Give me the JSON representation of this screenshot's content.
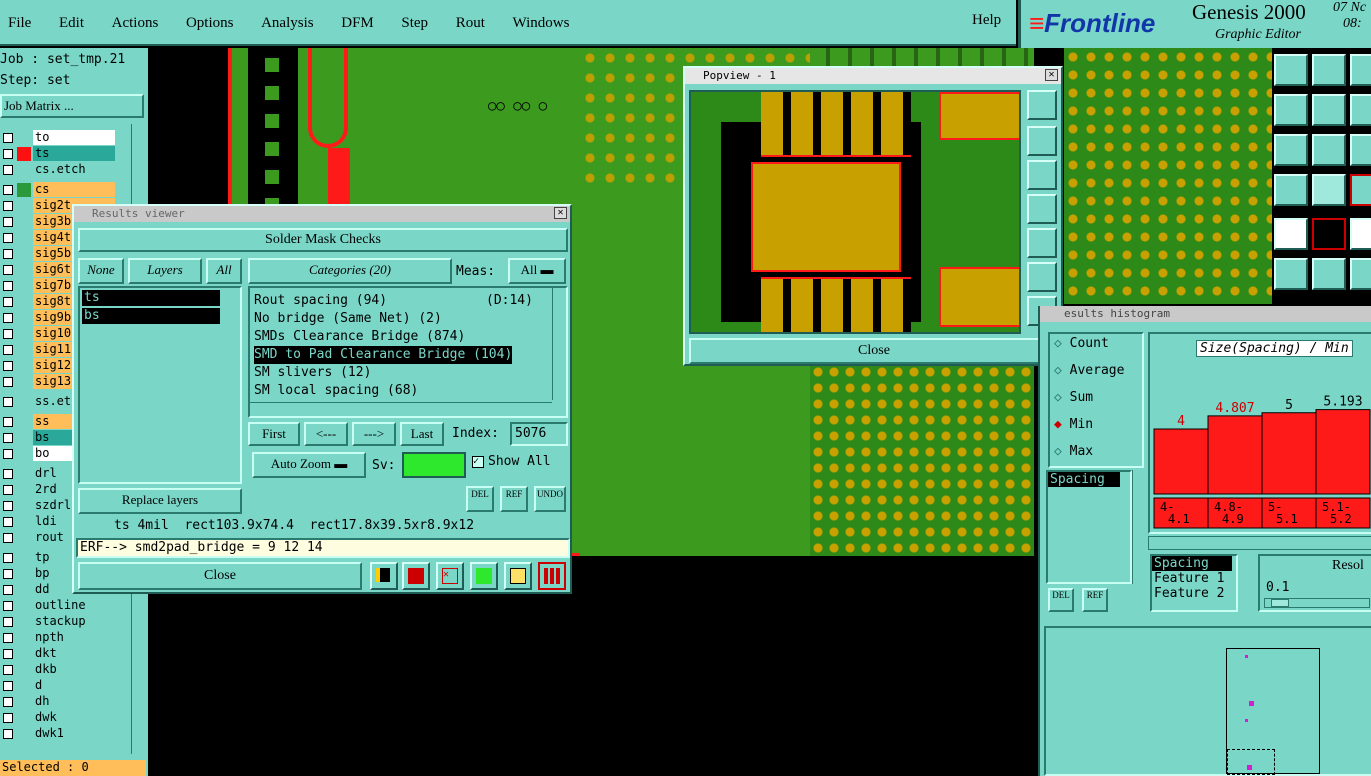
{
  "menu": {
    "items": [
      "File",
      "Edit",
      "Actions",
      "Options",
      "Analysis",
      "DFM",
      "Step",
      "Rout",
      "Windows"
    ],
    "help": "Help"
  },
  "brand": {
    "logo": "Frontline",
    "product": "Genesis 2000",
    "subtitle": "Graphic Editor",
    "date1": "07 Nc",
    "date2": "08:"
  },
  "left": {
    "job": "Job : set_tmp.21",
    "step": "Step: set",
    "job_matrix": "Job Matrix ...",
    "selected": "Selected : 0",
    "layers": [
      {
        "name": "to",
        "color": "#ffffff",
        "sw": ""
      },
      {
        "name": "ts",
        "color": "#2aa89a",
        "sw": "#ff1010"
      },
      {
        "name": "cs.etch",
        "color": "#7ad7c8",
        "sw": ""
      },
      {
        "name": "cs",
        "color": "#ffbe5a",
        "sw": "#2a9a3a"
      },
      {
        "name": "sig2t",
        "color": "#ffbe5a",
        "sw": ""
      },
      {
        "name": "sig3b",
        "color": "#ffbe5a",
        "sw": ""
      },
      {
        "name": "sig4t",
        "color": "#ffbe5a",
        "sw": ""
      },
      {
        "name": "sig5b",
        "color": "#ffbe5a",
        "sw": ""
      },
      {
        "name": "sig6t",
        "color": "#ffbe5a",
        "sw": ""
      },
      {
        "name": "sig7b",
        "color": "#ffbe5a",
        "sw": ""
      },
      {
        "name": "sig8t",
        "color": "#ffbe5a",
        "sw": ""
      },
      {
        "name": "sig9b",
        "color": "#ffbe5a",
        "sw": ""
      },
      {
        "name": "sig10",
        "color": "#ffbe5a",
        "sw": ""
      },
      {
        "name": "sig11",
        "color": "#ffbe5a",
        "sw": ""
      },
      {
        "name": "sig12",
        "color": "#ffbe5a",
        "sw": ""
      },
      {
        "name": "sig13",
        "color": "#ffbe5a",
        "sw": ""
      },
      {
        "name": "ss.et",
        "color": "#7ad7c8",
        "sw": ""
      },
      {
        "name": "ss",
        "color": "#ffbe5a",
        "sw": ""
      },
      {
        "name": "bs",
        "color": "#2aa89a",
        "sw": ""
      },
      {
        "name": "bo",
        "color": "#ffffff",
        "sw": ""
      },
      {
        "name": "drl",
        "color": "#7ad7c8",
        "sw": ""
      },
      {
        "name": "2rd",
        "color": "#7ad7c8",
        "sw": ""
      },
      {
        "name": "szdrl",
        "color": "#7ad7c8",
        "sw": ""
      },
      {
        "name": "ldi",
        "color": "#7ad7c8",
        "sw": ""
      },
      {
        "name": "rout",
        "color": "#7ad7c8",
        "sw": ""
      },
      {
        "name": "tp",
        "color": "#7ad7c8",
        "sw": ""
      },
      {
        "name": "bp",
        "color": "#7ad7c8",
        "sw": ""
      },
      {
        "name": "dd",
        "color": "#7ad7c8",
        "sw": ""
      },
      {
        "name": "outline",
        "color": "#7ad7c8",
        "sw": ""
      },
      {
        "name": "stackup",
        "color": "#7ad7c8",
        "sw": ""
      },
      {
        "name": "npth",
        "color": "#7ad7c8",
        "sw": ""
      },
      {
        "name": "dkt",
        "color": "#7ad7c8",
        "sw": ""
      },
      {
        "name": "dkb",
        "color": "#7ad7c8",
        "sw": ""
      },
      {
        "name": "d",
        "color": "#7ad7c8",
        "sw": ""
      },
      {
        "name": "dh",
        "color": "#7ad7c8",
        "sw": ""
      },
      {
        "name": "dwk",
        "color": "#7ad7c8",
        "sw": ""
      },
      {
        "name": "dwk1",
        "color": "#7ad7c8",
        "sw": ""
      }
    ]
  },
  "results": {
    "title": "Results viewer",
    "header": "Solder Mask Checks",
    "none": "None",
    "layers_label": "Layers",
    "all": "All",
    "layers": [
      "ts",
      "bs"
    ],
    "categories": "Categories (20)",
    "meas_label": "Meas:",
    "meas_value": "All",
    "cats": [
      "Rout spacing (94)",
      "No bridge (Same Net) (2)",
      "SMDs Clearance Bridge (874)",
      "SMD to Pad Clearance Bridge (104)",
      "SM slivers (12)",
      "SM local spacing (68)"
    ],
    "cat_extra": "(D:14)",
    "first": "First",
    "prev": "<---",
    "next": "--->",
    "last": "Last",
    "index_label": "Index:",
    "index_value": "5076",
    "auto_zoom": "Auto Zoom",
    "sv": "Sv:",
    "show_all": "Show All",
    "replace": "Replace layers",
    "del": "DEL",
    "ref": "REF",
    "undo": "UNDO",
    "status": "ts 4mil  rect103.9x74.4  rect17.8x39.5xr8.9x12",
    "erf": "ERF--> smd2pad_bridge = 9 12 14",
    "close": "Close"
  },
  "popview": {
    "title": "Popview - 1",
    "close": "Close"
  },
  "histogram": {
    "title": "esults histogram",
    "opts": [
      "Count",
      "Average",
      "Sum",
      "Min",
      "Max"
    ],
    "selected": "Min",
    "size_label": "Size(Spacing) / Min",
    "bars": [
      {
        "label": "4",
        "value": 4
      },
      {
        "label": "4.807",
        "value": 4.807
      },
      {
        "label": "5",
        "value": 5
      },
      {
        "label": "5.193",
        "value": 5.193
      }
    ],
    "ranges": [
      "4-\n4.1",
      "4.8-\n4.9",
      "5-\n5.1",
      "5.1-\n5.2"
    ],
    "list_sel": "Spacing",
    "list": [
      "Spacing",
      "Feature 1",
      "Feature 2"
    ],
    "resol": "Resol",
    "resol_val": "0.1",
    "del": "DEL",
    "ref": "REF"
  },
  "colors": {
    "board": "#3c9b1e",
    "copper": "#c8a000",
    "mask": "#7ad7c8",
    "red": "#ff1a1a"
  }
}
